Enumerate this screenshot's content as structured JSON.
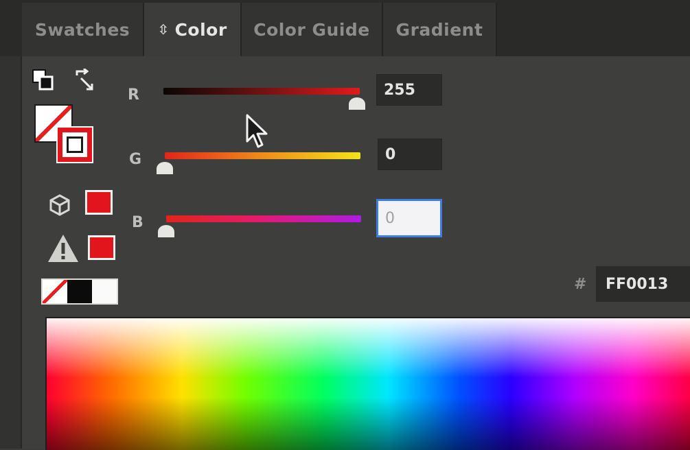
{
  "tabs": [
    {
      "label": "Swatches",
      "active": false
    },
    {
      "label": "Color",
      "active": true,
      "icon": "up-down-arrows-icon"
    },
    {
      "label": "Color Guide",
      "active": false
    },
    {
      "label": "Gradient",
      "active": false
    }
  ],
  "tools": {
    "default_colors_icon": "default-fill-stroke-icon",
    "swap_icon": "swap-fill-stroke-icon",
    "fill": "none",
    "stroke_color": "#e3151c"
  },
  "warnings": {
    "web_safe_icon": "cube-icon",
    "gamut_icon": "warning-triangle-icon",
    "swatch_color": "#e3151c"
  },
  "quick_colors": [
    "none",
    "black",
    "white"
  ],
  "channels": [
    {
      "label": "R",
      "value": "255",
      "level": 1.0
    },
    {
      "label": "G",
      "value": "0",
      "level": 0.0
    },
    {
      "label": "B",
      "value": "0",
      "level": 0.0,
      "focused": true
    }
  ],
  "hex": {
    "prefix": "#",
    "value": "FF0013"
  },
  "colors": {
    "panel_bg": "#3e3e3c",
    "accent_focus": "#3d7be6",
    "current_red": "#e3151c"
  }
}
